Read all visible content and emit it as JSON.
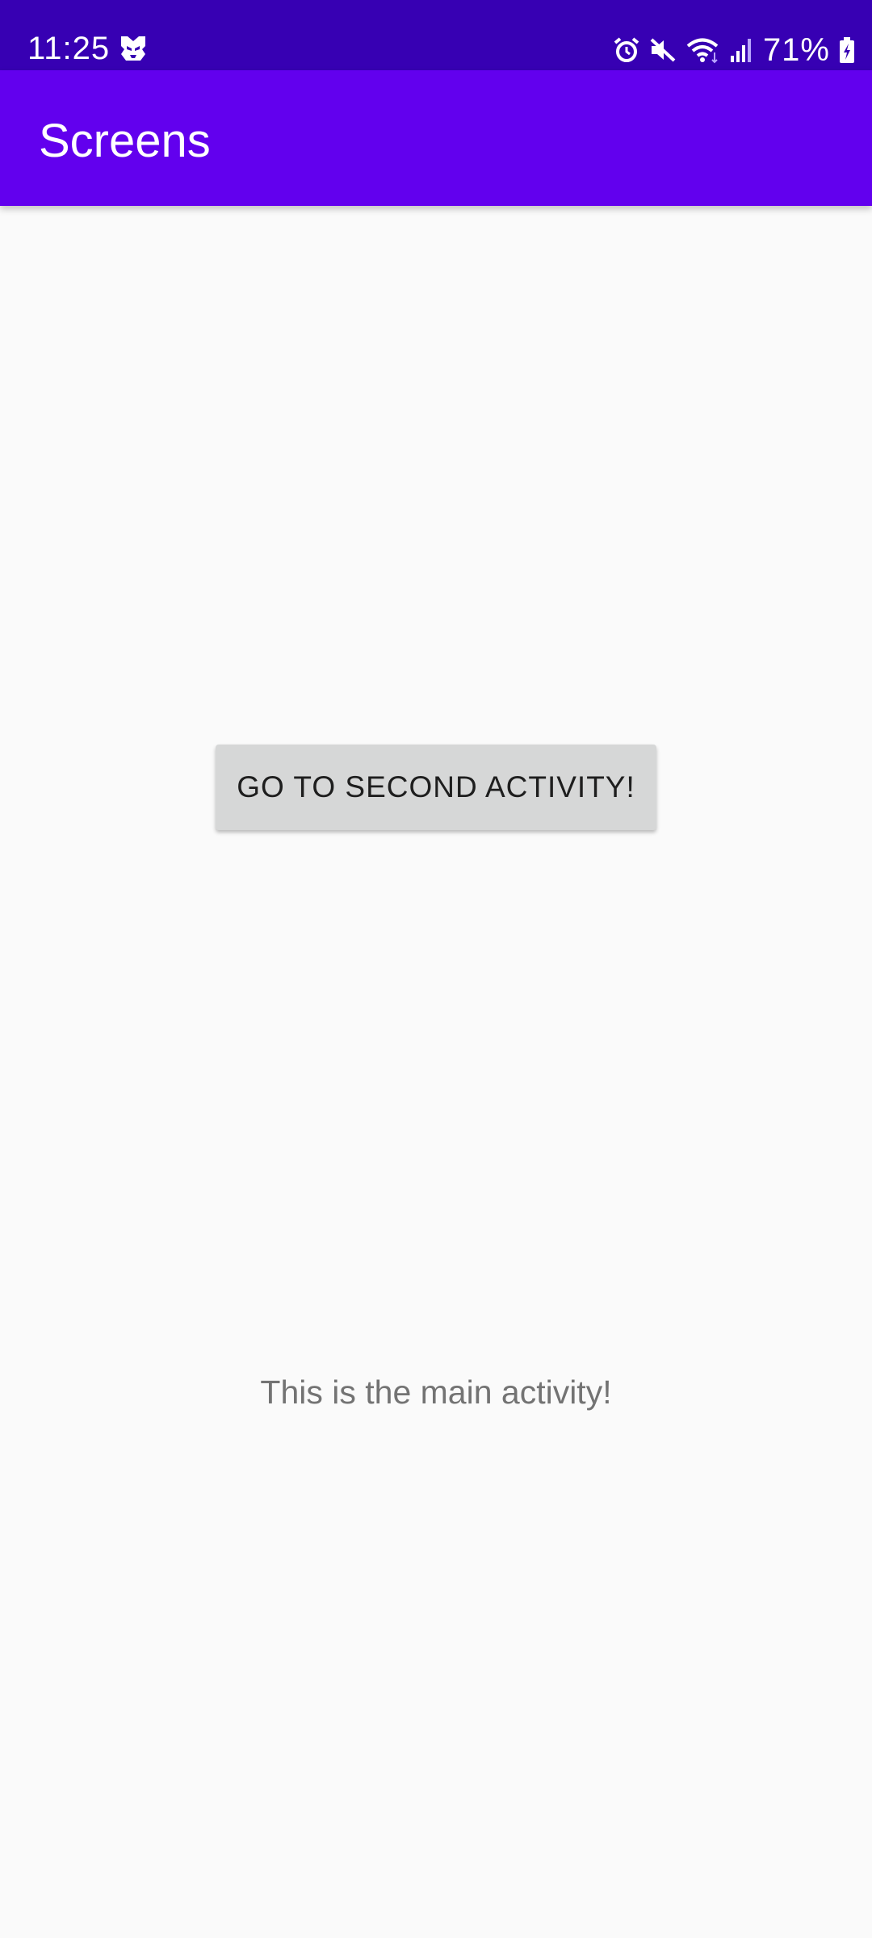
{
  "status_bar": {
    "time": "11:25",
    "battery_percent": "71%",
    "icons": [
      "transformers-logo-icon",
      "alarm-icon",
      "mute-icon",
      "wifi-icon",
      "signal-icon",
      "battery-charging-icon"
    ]
  },
  "app_bar": {
    "title": "Screens"
  },
  "main": {
    "button_label": "GO TO SECOND ACTIVITY!",
    "text": "This is the main activity!"
  },
  "colors": {
    "status_bar": "#3700b3",
    "app_bar": "#6200ee",
    "background": "#fafafa",
    "button": "#d6d7d7"
  }
}
